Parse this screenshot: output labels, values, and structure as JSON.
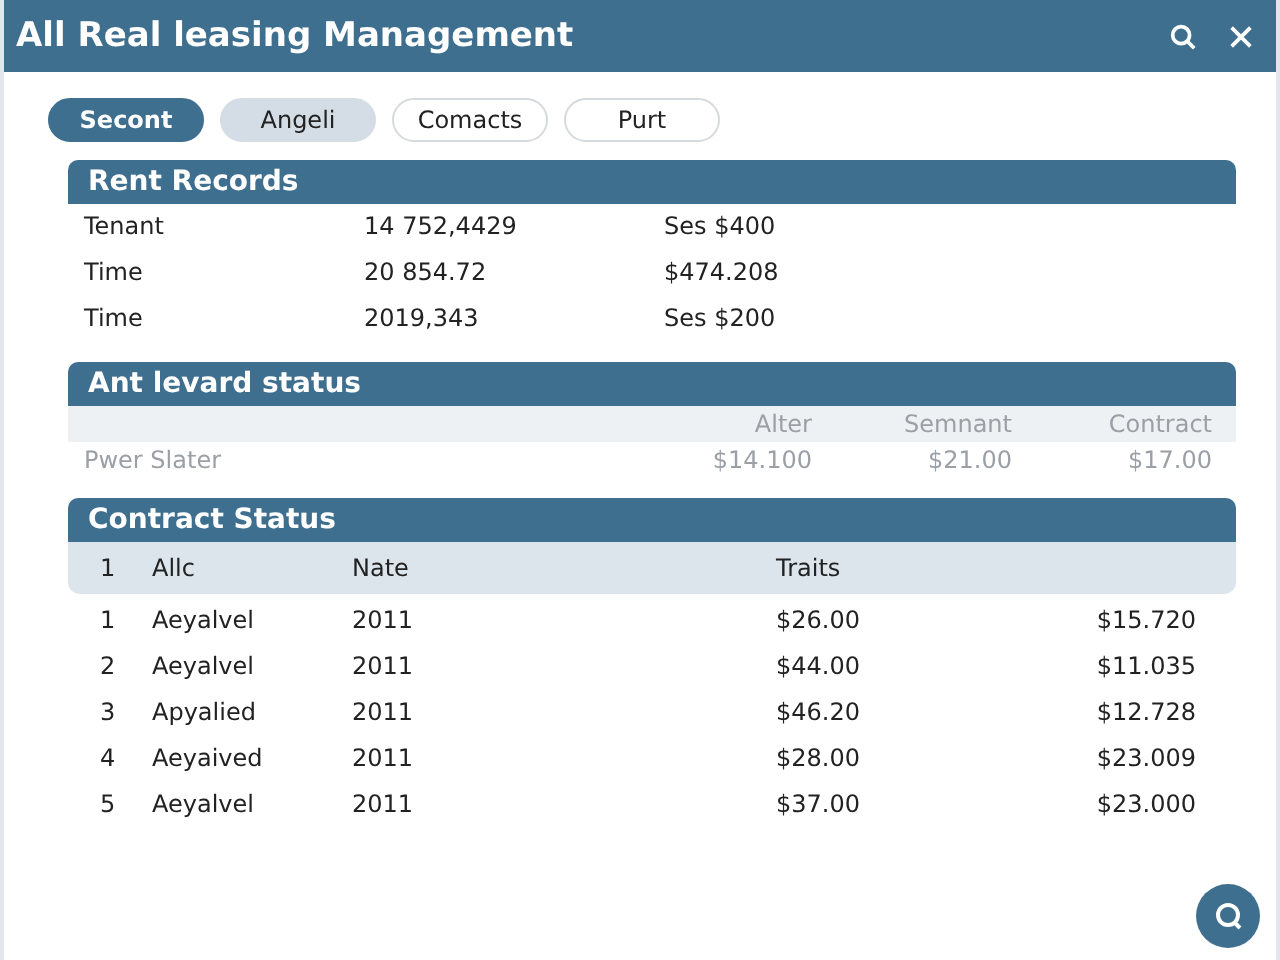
{
  "window": {
    "title": "All Real leasing Management"
  },
  "tabs": [
    {
      "label": "Secont",
      "selected": true,
      "highlighted": false
    },
    {
      "label": "Angeli",
      "selected": false,
      "highlighted": true
    },
    {
      "label": "Comacts",
      "selected": false,
      "highlighted": false
    },
    {
      "label": "Purt",
      "selected": false,
      "highlighted": false
    }
  ],
  "rent_records": {
    "title": "Rent Records",
    "rows": [
      [
        "Tenant",
        "14 752,4429",
        "Ses $400"
      ],
      [
        "Time",
        "20 854.72",
        "$474.208"
      ],
      [
        "Time",
        "2019,343",
        "Ses $200"
      ]
    ]
  },
  "status_section": {
    "title": "Ant levard status",
    "columns": [
      "",
      "Alter",
      "Semnant",
      "Contract"
    ],
    "rows": [
      [
        "Pwer Slater",
        "$14.100",
        "$21.00",
        "$17.00"
      ]
    ]
  },
  "contract_status": {
    "title": "Contract Status",
    "columns": [
      "1",
      "Allc",
      "Nate",
      "Traits"
    ],
    "rows": [
      [
        "1",
        "Aeyalvel",
        "2011",
        "$26.00",
        "$15.720"
      ],
      [
        "2",
        "Aeyalvel",
        "2011",
        "$44.00",
        "$11.035"
      ],
      [
        "3",
        "Apyalied",
        "2011",
        "$46.20",
        "$12.728"
      ],
      [
        "4",
        "Aeyaived",
        "2011",
        "$28.00",
        "$23.009"
      ],
      [
        "5",
        "Aeyalvel",
        "2011",
        "$37.00",
        "$23.000"
      ]
    ]
  }
}
